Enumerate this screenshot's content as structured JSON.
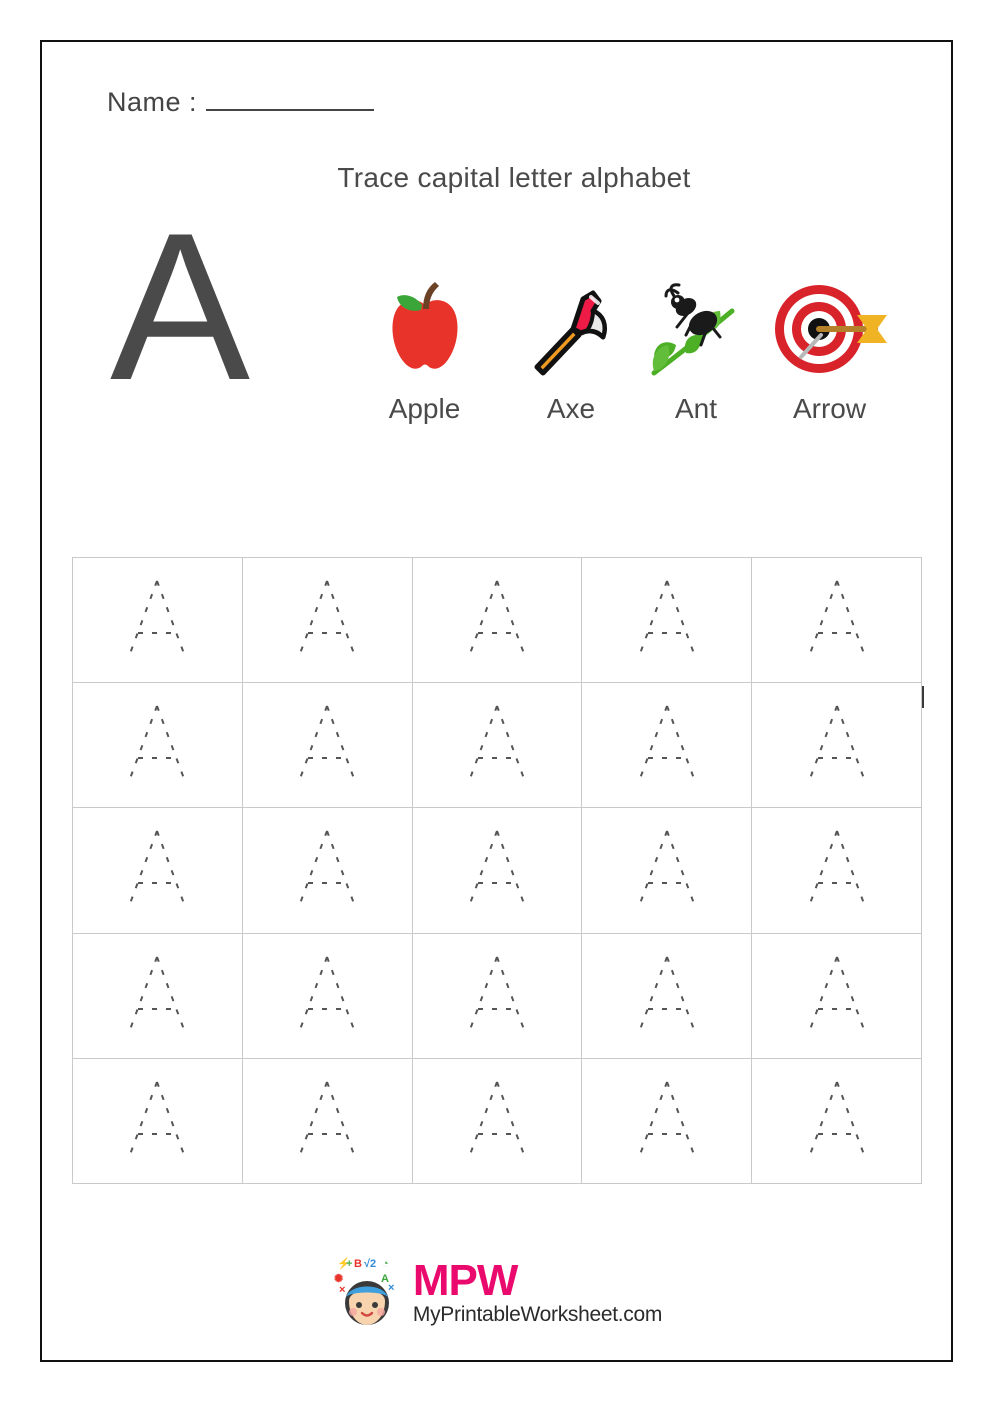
{
  "page": {
    "name_label": "Name :",
    "title": "Trace capital letter alphabet",
    "big_letter": "A"
  },
  "examples": [
    {
      "label": "Apple",
      "icon": "apple-icon"
    },
    {
      "label": "Axe",
      "icon": "axe-icon"
    },
    {
      "label": "Ant",
      "icon": "ant-icon"
    },
    {
      "label": "Arrow",
      "icon": "arrow-target-icon"
    }
  ],
  "trace_grid": {
    "rows": 5,
    "columns": 5,
    "total_cells": 25,
    "letter": "A",
    "style": "dashed-outline"
  },
  "footer": {
    "logo_text": "MPW",
    "site": "MyPrintableWorksheet.com",
    "mascot_icon": "student-face-icon"
  },
  "colors": {
    "page_border": "#111111",
    "text": "#4a4a4a",
    "grid_line": "#c9c9c9",
    "apple_red": "#e8332a",
    "leaf_green": "#3aa63a",
    "stem_brown": "#6b4226",
    "axe_red": "#ed1b45",
    "axe_handle": "#f09a21",
    "target_red": "#d8232a",
    "arrow_gold": "#f0b323",
    "ant_black": "#1a1a1a",
    "logo_pink": "#ea0a6e",
    "logo_site": "#2b2b2b"
  }
}
